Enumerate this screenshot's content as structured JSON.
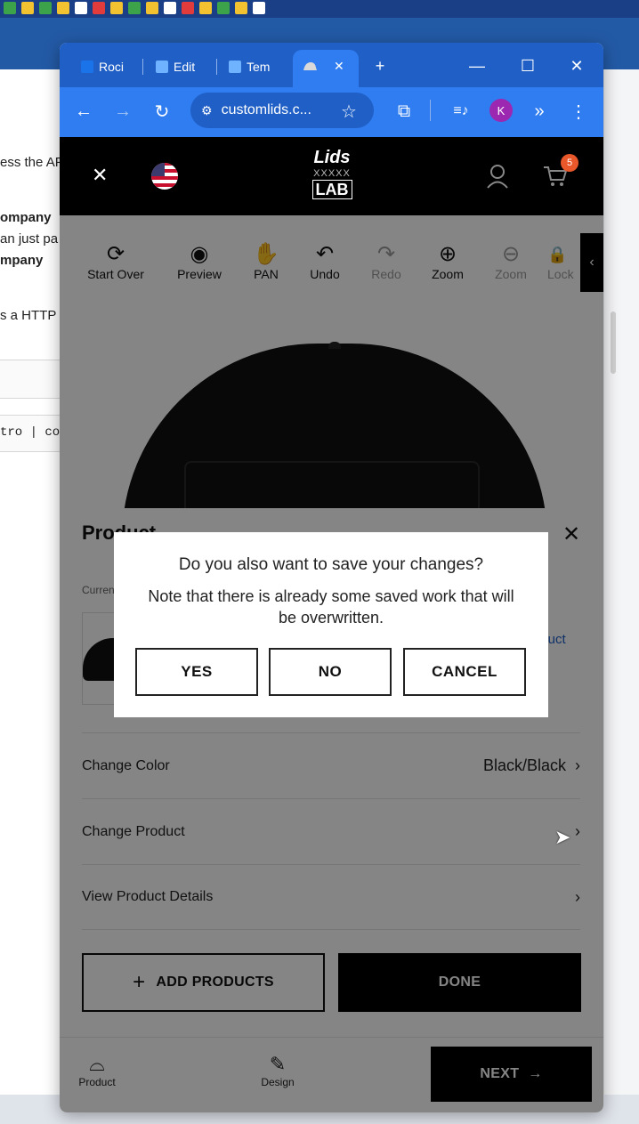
{
  "desktop": {
    "background_text": [
      "ess the AP",
      "ompany",
      "an just pa",
      "mpany",
      "s a HTTP",
      "tro | cor"
    ]
  },
  "browser": {
    "tabs": [
      {
        "label": "Roci",
        "icon": "bookmark-icon",
        "color": "#1a73e8"
      },
      {
        "label": "Edit",
        "icon": "ztag-icon",
        "color": "#6fb2ff"
      },
      {
        "label": "Tem",
        "icon": "ztag-icon",
        "color": "#6fb2ff"
      },
      {
        "label": "",
        "icon": "cap-favicon",
        "active": true
      }
    ],
    "tab_close": "✕",
    "new_tab": "+",
    "window_controls": {
      "minimize": "—",
      "maximize": "☐",
      "close": "✕"
    },
    "nav": {
      "back": "←",
      "forward": "→",
      "reload": "↻"
    },
    "url": "customlids.c...",
    "avatar_letter": "K",
    "accent": "#2f7df1"
  },
  "site": {
    "header_close": "✕",
    "logo": {
      "line1": "Lids",
      "line2": "XXXXX",
      "line3": "LAB"
    },
    "cart_count": "5",
    "tools": [
      {
        "label": "Start Over",
        "icon": "⟳",
        "name": "start-over"
      },
      {
        "label": "Preview",
        "icon": "◉",
        "name": "preview"
      },
      {
        "label": "PAN",
        "icon": "✋",
        "name": "pan"
      },
      {
        "label": "Undo",
        "icon": "↶",
        "name": "undo"
      },
      {
        "label": "Redo",
        "icon": "↷",
        "name": "redo",
        "disabled": true
      },
      {
        "label": "Zoom",
        "icon": "⊕",
        "name": "zoom-in"
      },
      {
        "label": "Zoom",
        "icon": "⊖",
        "name": "zoom-out",
        "disabled": true
      },
      {
        "label": "Lock",
        "icon": "🔒",
        "name": "lock",
        "disabled": true
      }
    ],
    "side_toggle": "‹"
  },
  "panel": {
    "title": "Product",
    "close": "✕",
    "current_label": "Current",
    "change_link": "oduct",
    "rows": [
      {
        "label": "Change Color",
        "value": "Black/Black",
        "chevron": "›"
      },
      {
        "label": "Change Product",
        "value": "",
        "chevron": "›"
      },
      {
        "label": "View Product Details",
        "value": "",
        "chevron": "›"
      }
    ],
    "add_products": "ADD PRODUCTS",
    "add_icon": "+",
    "done": "DONE"
  },
  "bottom_nav": {
    "product": "Product",
    "design": "Design",
    "next": "NEXT",
    "next_arrow": "→"
  },
  "dialog": {
    "question": "Do you also want to save your changes?",
    "note": "Note that there is already some saved work that will be overwritten.",
    "yes": "YES",
    "no": "NO",
    "cancel": "CANCEL"
  }
}
